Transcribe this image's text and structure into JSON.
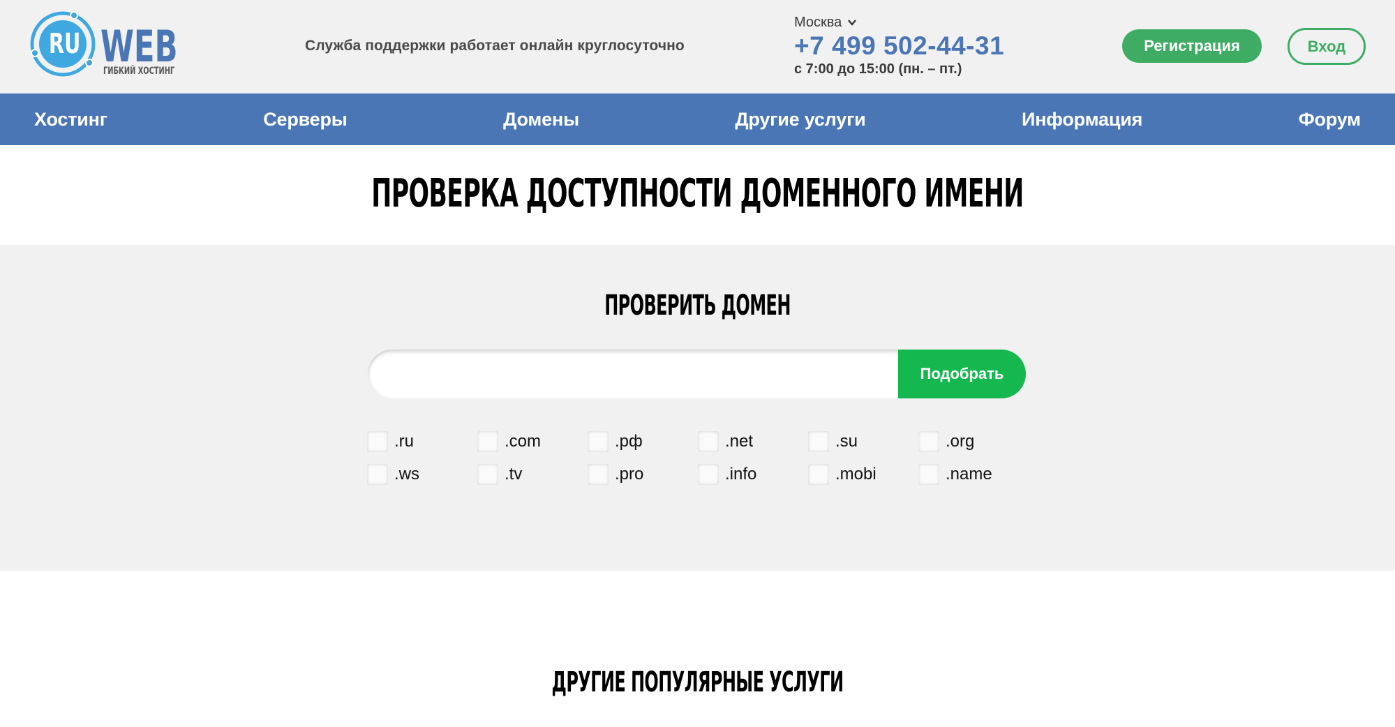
{
  "header": {
    "logo": {
      "badge_text": "RU",
      "brand_text": "WEB",
      "tagline": "ГИБКИЙ ХОСТИНГ",
      "colors": {
        "ring": "#3fa8e0",
        "brand": "#4a76b5",
        "tagline": "#555555"
      }
    },
    "support_text": "Служба поддержки работает онлайн круглосуточно",
    "city": "Москва",
    "phone": "+7 499 502-44-31",
    "hours": "с 7:00 до 15:00 (пн. – пт.)",
    "register_label": "Регистрация",
    "login_label": "Вход"
  },
  "nav": {
    "items": [
      {
        "label": "Хостинг"
      },
      {
        "label": "Серверы"
      },
      {
        "label": "Домены"
      },
      {
        "label": "Другие услуги"
      },
      {
        "label": "Информация"
      },
      {
        "label": "Форум"
      }
    ]
  },
  "page_title": "ПРОВЕРКА ДОСТУПНОСТИ ДОМЕННОГО ИМЕНИ",
  "check": {
    "title": "ПРОВЕРИТЬ ДОМЕН",
    "input_value": "",
    "input_placeholder": "",
    "submit_label": "Подобрать",
    "zones": [
      {
        "label": ".ru",
        "checked": false
      },
      {
        "label": ".com",
        "checked": false
      },
      {
        "label": ".рф",
        "checked": false
      },
      {
        "label": ".net",
        "checked": false
      },
      {
        "label": ".su",
        "checked": false
      },
      {
        "label": ".org",
        "checked": false
      },
      {
        "label": ".ws",
        "checked": false
      },
      {
        "label": ".tv",
        "checked": false
      },
      {
        "label": ".pro",
        "checked": false
      },
      {
        "label": ".info",
        "checked": false
      },
      {
        "label": ".mobi",
        "checked": false
      },
      {
        "label": ".name",
        "checked": false
      }
    ]
  },
  "other_services_title": "ДРУГИЕ ПОПУЛЯРНЫЕ УСЛУГИ",
  "colors": {
    "primary_blue": "#4a76b5",
    "green": "#3fac63",
    "search_green": "#14b84e",
    "gray_bg": "#f1f1f1"
  }
}
